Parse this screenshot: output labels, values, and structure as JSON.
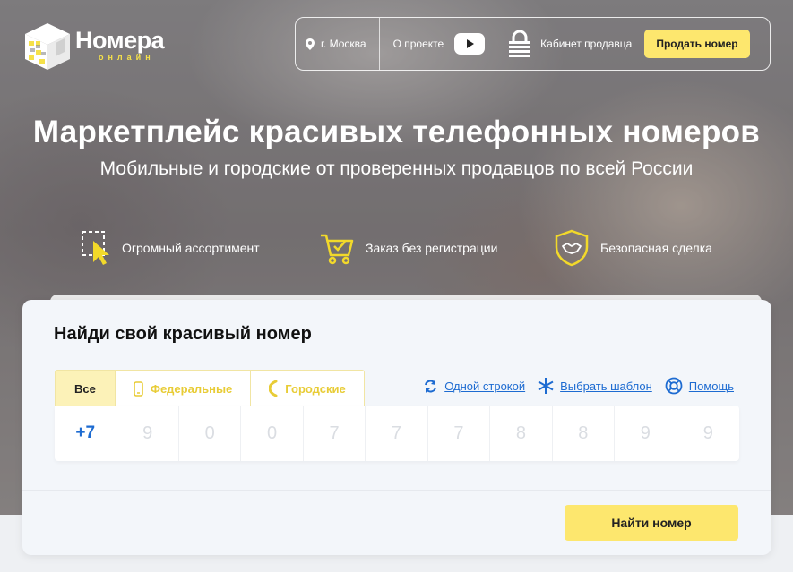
{
  "logo": {
    "title": "Номера",
    "subtitle": "онлайн"
  },
  "nav": {
    "city": "г. Москва",
    "about": "О проекте",
    "cabinet": "Кабинет продавца",
    "sell_button": "Продать номер"
  },
  "hero": {
    "title": "Маркетплейс красивых телефонных номеров",
    "subtitle": "Мобильные и городские от проверенных продавцов по всей России"
  },
  "features": [
    {
      "label": "Огромный ассортимент",
      "icon": "cursor-selection-icon"
    },
    {
      "label": "Заказ без регистрации",
      "icon": "cart-check-icon"
    },
    {
      "label": "Безопасная сделка",
      "icon": "shield-handshake-icon"
    }
  ],
  "search": {
    "title": "Найди свой красивый номер",
    "tabs": [
      {
        "label": "Все",
        "active": true
      },
      {
        "label": "Федеральные",
        "icon": "mobile-phone-icon"
      },
      {
        "label": "Городские",
        "icon": "handset-icon"
      }
    ],
    "links": {
      "one_line": "Одной строкой",
      "template": "Выбрать шаблон",
      "help": "Помощь"
    },
    "prefix": "+7",
    "digits": [
      "9",
      "0",
      "0",
      "7",
      "7",
      "7",
      "8",
      "8",
      "9",
      "9"
    ],
    "find_button": "Найти номер"
  },
  "colors": {
    "accent_yellow": "#fde76e",
    "link_blue": "#1d6bd1",
    "icon_yellow": "#f2d92a"
  }
}
